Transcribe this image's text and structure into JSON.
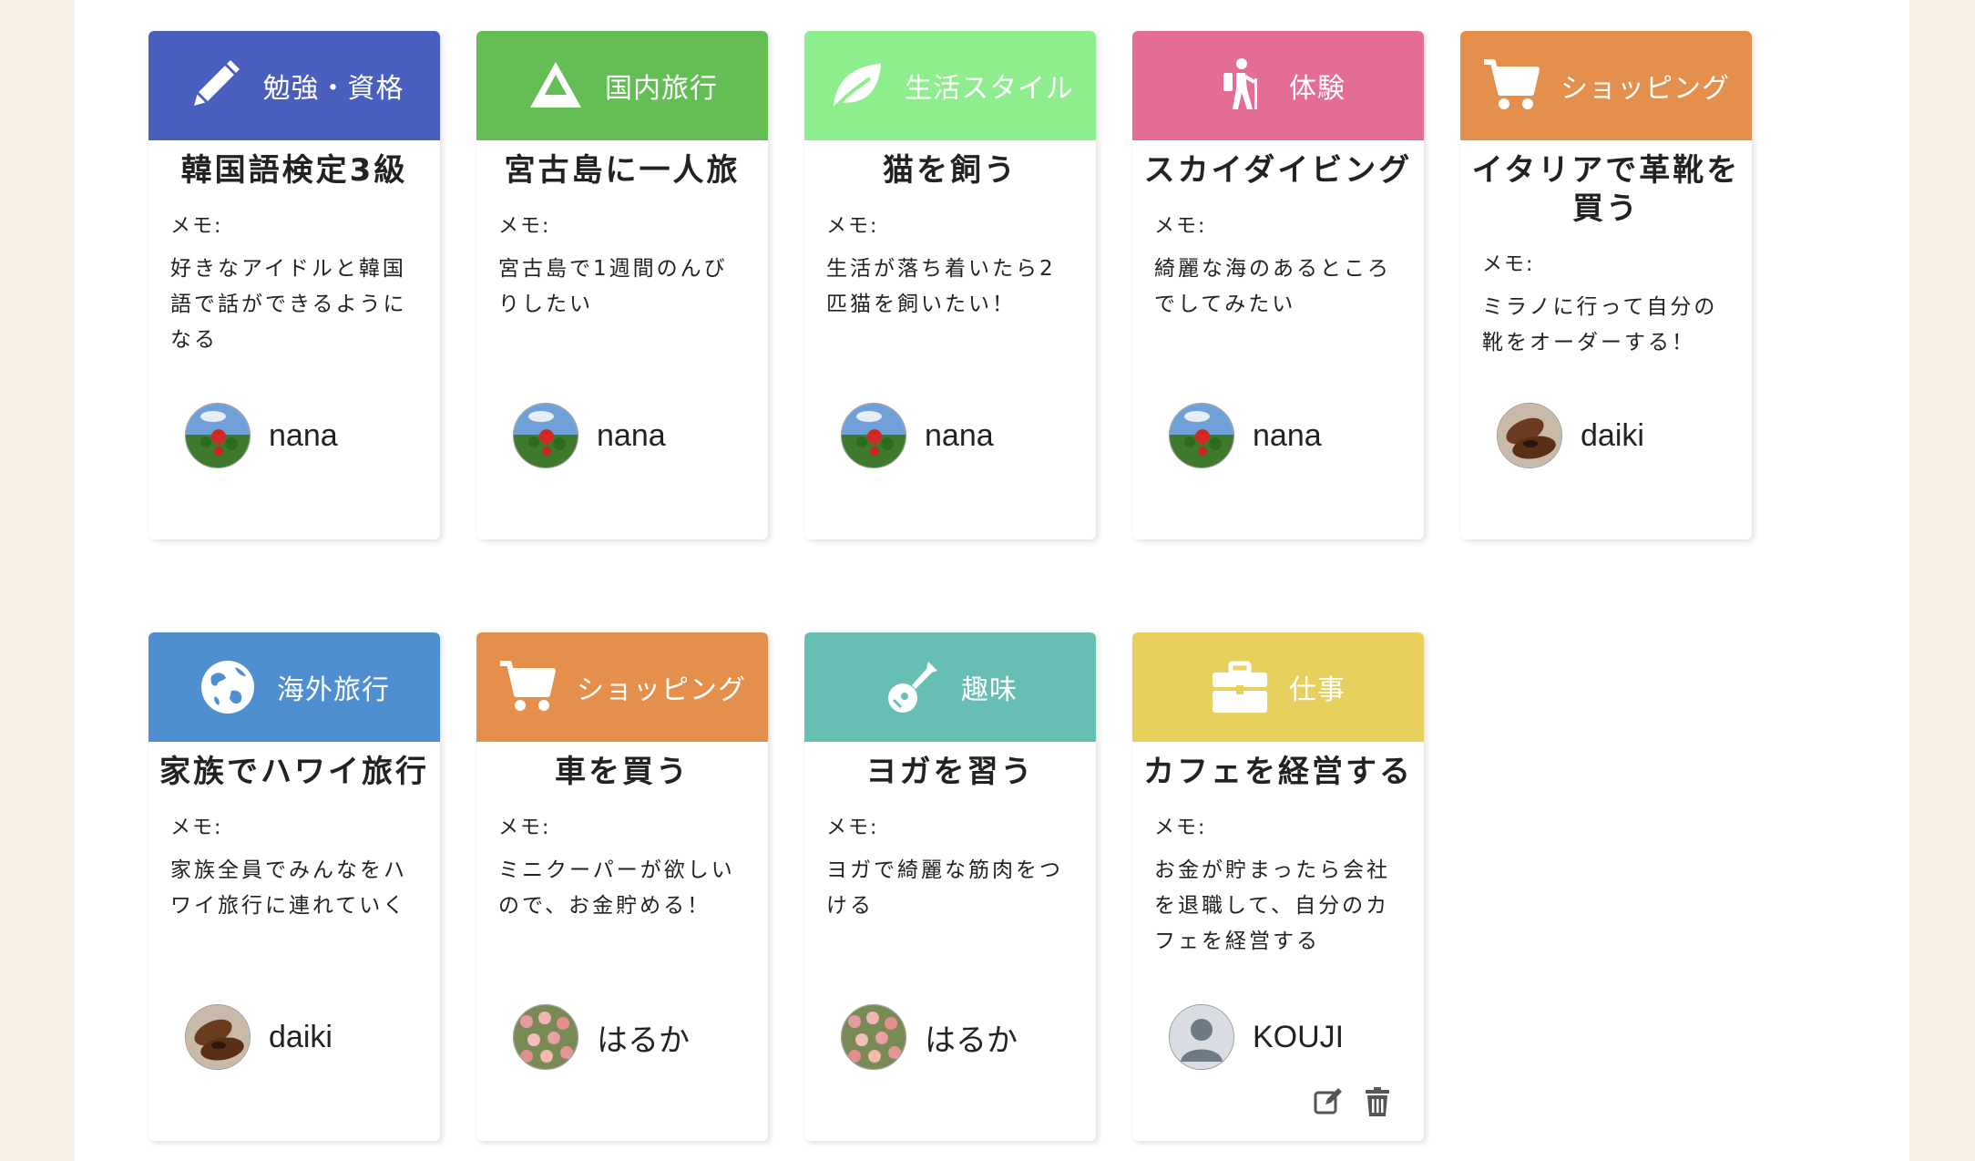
{
  "colors": {
    "study": "#4a5fbd",
    "domestic_travel": "#65bd56",
    "lifestyle": "#8eee8e",
    "experience": "#e36d96",
    "shopping": "#e4904c",
    "overseas_travel": "#4f8fd0",
    "hobby": "#67bfb3",
    "work": "#e7d05e"
  },
  "cards": [
    {
      "category": "勉強・資格",
      "icon": "pencil-icon",
      "title": "韓国語検定3級",
      "memo_label": "メモ:",
      "memo": "好きなアイドルと韓国語で話ができるようになる",
      "user": "nana",
      "avatar": "flower-avatar"
    },
    {
      "category": "国内旅行",
      "icon": "mountain-icon",
      "title": "宮古島に一人旅",
      "memo_label": "メモ:",
      "memo": "宮古島で1週間のんびりしたい",
      "user": "nana",
      "avatar": "flower-avatar"
    },
    {
      "category": "生活スタイル",
      "icon": "leaf-icon",
      "title": "猫を飼う",
      "memo_label": "メモ:",
      "memo": "生活が落ち着いたら2匹猫を飼いたい！",
      "user": "nana",
      "avatar": "flower-avatar"
    },
    {
      "category": "体験",
      "icon": "hiking-icon",
      "title": "スカイダイビング",
      "memo_label": "メモ:",
      "memo": "綺麗な海のあるところでしてみたい",
      "user": "nana",
      "avatar": "flower-avatar"
    },
    {
      "category": "ショッピング",
      "icon": "cart-icon",
      "title": "イタリアで革靴を買う",
      "memo_label": "メモ:",
      "memo": "ミラノに行って自分の靴をオーダーする！",
      "user": "daiki",
      "avatar": "shoes-avatar"
    },
    {
      "category": "海外旅行",
      "icon": "globe-icon",
      "title": "家族でハワイ旅行",
      "memo_label": "メモ:",
      "memo": "家族全員でみんなをハワイ旅行に連れていく",
      "user": "daiki",
      "avatar": "shoes-avatar"
    },
    {
      "category": "ショッピング",
      "icon": "cart-icon",
      "title": "車を買う",
      "memo_label": "メモ:",
      "memo": "ミニクーパーが欲しいので、お金貯める！",
      "user": "はるか",
      "avatar": "roses-avatar"
    },
    {
      "category": "趣味",
      "icon": "guitar-icon",
      "title": "ヨガを習う",
      "memo_label": "メモ:",
      "memo": "ヨガで綺麗な筋肉をつける",
      "user": "はるか",
      "avatar": "roses-avatar"
    },
    {
      "category": "仕事",
      "icon": "briefcase-icon",
      "title": "カフェを経営する",
      "memo_label": "メモ:",
      "memo": "お金が貯まったら会社を退職して、自分のカフェを経営する",
      "user": "KOUJI",
      "avatar": "default-user-avatar",
      "editable": true
    }
  ]
}
